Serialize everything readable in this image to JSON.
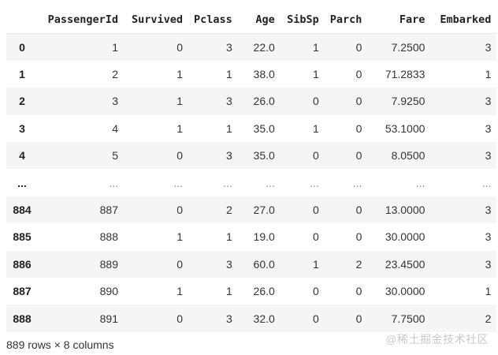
{
  "dataframe": {
    "columns": [
      "PassengerId",
      "Survived",
      "Pclass",
      "Age",
      "SibSp",
      "Parch",
      "Fare",
      "Embarked"
    ],
    "rows": [
      {
        "index": "0",
        "cells": [
          "1",
          "0",
          "3",
          "22.0",
          "1",
          "0",
          "7.2500",
          "3"
        ]
      },
      {
        "index": "1",
        "cells": [
          "2",
          "1",
          "1",
          "38.0",
          "1",
          "0",
          "71.2833",
          "1"
        ]
      },
      {
        "index": "2",
        "cells": [
          "3",
          "1",
          "3",
          "26.0",
          "0",
          "0",
          "7.9250",
          "3"
        ]
      },
      {
        "index": "3",
        "cells": [
          "4",
          "1",
          "1",
          "35.0",
          "1",
          "0",
          "53.1000",
          "3"
        ]
      },
      {
        "index": "4",
        "cells": [
          "5",
          "0",
          "3",
          "35.0",
          "0",
          "0",
          "8.0500",
          "3"
        ]
      },
      {
        "index": "...",
        "cells": [
          "...",
          "...",
          "...",
          "...",
          "...",
          "...",
          "...",
          "..."
        ]
      },
      {
        "index": "884",
        "cells": [
          "887",
          "0",
          "2",
          "27.0",
          "0",
          "0",
          "13.0000",
          "3"
        ]
      },
      {
        "index": "885",
        "cells": [
          "888",
          "1",
          "1",
          "19.0",
          "0",
          "0",
          "30.0000",
          "3"
        ]
      },
      {
        "index": "886",
        "cells": [
          "889",
          "0",
          "3",
          "60.0",
          "1",
          "2",
          "23.4500",
          "3"
        ]
      },
      {
        "index": "887",
        "cells": [
          "890",
          "1",
          "1",
          "26.0",
          "0",
          "0",
          "30.0000",
          "1"
        ]
      },
      {
        "index": "888",
        "cells": [
          "891",
          "0",
          "3",
          "32.0",
          "0",
          "0",
          "7.7500",
          "2"
        ]
      }
    ],
    "shape_text": "889 rows × 8 columns"
  },
  "watermark": "@稀土掘金技术社区",
  "colors": {
    "stripe": "#f5f5f5",
    "text": "#212121",
    "watermark": "#c9c9c9"
  }
}
